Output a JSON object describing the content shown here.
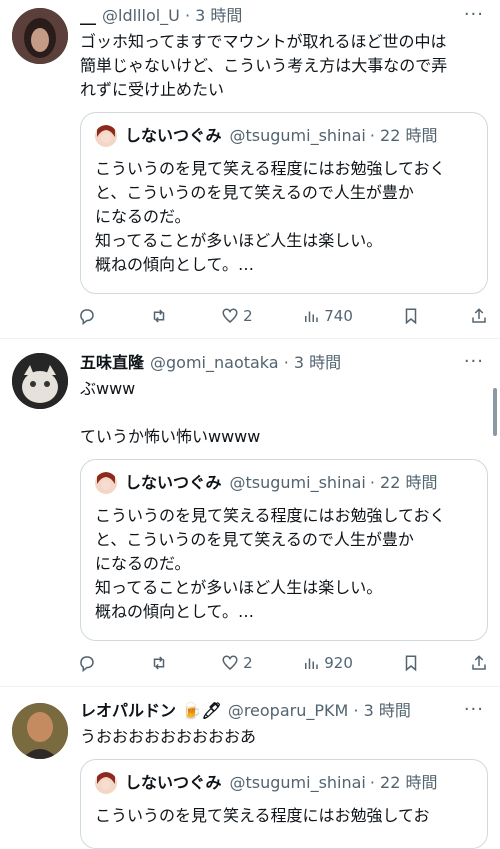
{
  "posts": [
    {
      "name": "__",
      "handle": "@ldlllol_U",
      "time": "· 3 時間",
      "text": "ゴッホ知ってますでマウントが取れるほど世の中は\n簡単じゃないけど、こういう考え方は大事なので弄\nれずに受け止めたい",
      "quote": {
        "name": "しないつぐみ",
        "handle": "@tsugumi_shinai",
        "time": "· 22 時間",
        "text": "こういうのを見て笑える程度にはお勉強しておく\nと、こういうのを見て笑えるので人生が豊か\nになるのだ。\n知ってることが多いほど人生は楽しい。\n概ねの傾向として。…"
      },
      "actions": {
        "reply": "",
        "repost": "",
        "like": "2",
        "views": "740"
      }
    },
    {
      "name": "五味直隆",
      "handle": "@gomi_naotaka",
      "time": "· 3 時間",
      "text": "ぶwww\n\nていうか怖い怖いwwww",
      "quote": {
        "name": "しないつぐみ",
        "handle": "@tsugumi_shinai",
        "time": "· 22 時間",
        "text": "こういうのを見て笑える程度にはお勉強しておく\nと、こういうのを見て笑えるので人生が豊か\nになるのだ。\n知ってることが多いほど人生は楽しい。\n概ねの傾向として。…"
      },
      "actions": {
        "reply": "",
        "repost": "",
        "like": "2",
        "views": "920"
      }
    },
    {
      "name": "レオパルドン 🍺🖊",
      "handle": "@reoparu_PKM",
      "time": "· 3 時間",
      "text": "うおおおおおおおおおあ",
      "quote": {
        "name": "しないつぐみ",
        "handle": "@tsugumi_shinai",
        "time": "· 22 時間",
        "text": "こういうのを見て笑える程度にはお勉強してお"
      }
    }
  ],
  "more_icon": "···",
  "colors": {
    "text": "#0f1419",
    "secondary": "#536471",
    "border": "#cfd9de"
  }
}
